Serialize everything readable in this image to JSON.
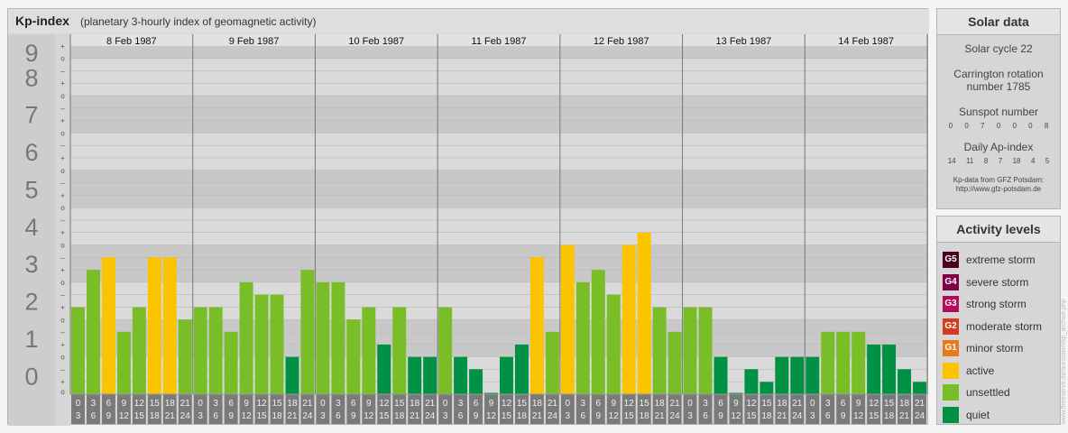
{
  "header": {
    "title": "Kp-index",
    "subtitle": "(planetary 3-hourly index of geomagnetic activity)"
  },
  "chart_data": {
    "type": "bar",
    "y_levels": [
      "0",
      "1",
      "2",
      "3",
      "4",
      "5",
      "6",
      "7",
      "8",
      "9"
    ],
    "sub_ticks": [
      "o",
      "+",
      "–"
    ],
    "ylim": [
      0,
      9.33
    ],
    "days": [
      "8 Feb 1987",
      "9 Feb 1987",
      "10 Feb 1987",
      "11 Feb 1987",
      "12 Feb 1987",
      "13 Feb 1987",
      "14 Feb 1987"
    ],
    "hour_start": [
      "0",
      "3",
      "6",
      "9",
      "12",
      "15",
      "18",
      "21"
    ],
    "hour_end": [
      "3",
      "6",
      "9",
      "12",
      "15",
      "18",
      "21",
      "24"
    ],
    "values": [
      [
        2.33,
        3.33,
        3.67,
        1.67,
        2.33,
        3.67,
        3.67,
        2.0
      ],
      [
        2.33,
        2.33,
        1.67,
        3.0,
        2.67,
        2.67,
        1.0,
        3.33
      ],
      [
        3.0,
        3.0,
        2.0,
        2.33,
        1.33,
        2.33,
        1.0,
        1.0
      ],
      [
        2.33,
        1.0,
        0.67,
        0.0,
        1.0,
        1.33,
        3.67,
        1.67
      ],
      [
        4.0,
        3.0,
        3.33,
        2.67,
        4.0,
        4.33,
        2.33,
        1.67
      ],
      [
        2.33,
        2.33,
        1.0,
        0.0,
        0.67,
        0.33,
        1.0,
        1.0
      ],
      [
        1.0,
        1.67,
        1.67,
        1.67,
        1.33,
        1.33,
        0.67,
        0.33
      ]
    ],
    "colors": {
      "quiet": "#009145",
      "unsettled": "#79bd27",
      "active": "#fcc400",
      "minor_storm": "#e77b1b",
      "moderate_storm": "#d43c1f",
      "strong_storm": "#b5095c",
      "severe_storm": "#800048",
      "extreme_storm": "#4c0021"
    }
  },
  "solar": {
    "title": "Solar data",
    "cycle": "Solar cycle 22",
    "carrington_line1": "Carrington rotation",
    "carrington_line2": "number 1785",
    "sunspot_label": "Sunspot number",
    "sunspot_values": [
      "0",
      "0",
      "7",
      "0",
      "0",
      "0",
      "8"
    ],
    "ap_label": "Daily Ap-index",
    "ap_values": [
      "14",
      "11",
      "8",
      "7",
      "18",
      "4",
      "5"
    ],
    "source_line1": "Kp-data from GFZ Potsdam:",
    "source_line2": "http://www.gfz-potsdam.de"
  },
  "activity": {
    "title": "Activity levels",
    "levels": [
      {
        "code": "G5",
        "label": "extreme storm",
        "color": "#4c0021"
      },
      {
        "code": "G4",
        "label": "severe storm",
        "color": "#800048"
      },
      {
        "code": "G3",
        "label": "strong storm",
        "color": "#b5095c"
      },
      {
        "code": "G2",
        "label": "moderate storm",
        "color": "#d43c1f"
      },
      {
        "code": "G1",
        "label": "minor storm",
        "color": "#e77b1b"
      },
      {
        "code": "",
        "label": "active",
        "color": "#fcc400"
      },
      {
        "code": "",
        "label": "unsettled",
        "color": "#79bd27"
      },
      {
        "code": "",
        "label": "quiet",
        "color": "#009145"
      }
    ]
  },
  "watermark": "www.ffreeserve.de/auroralert/kp_archive.php"
}
